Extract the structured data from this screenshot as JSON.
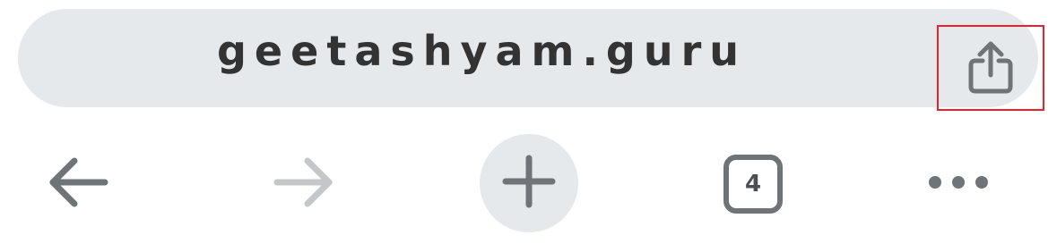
{
  "address_bar": {
    "url": "geetashyam.guru",
    "share_icon": "share-icon"
  },
  "toolbar": {
    "back_icon": "arrow-left-icon",
    "forward_icon": "arrow-right-icon",
    "new_tab_icon": "plus-icon",
    "tab_count": "4",
    "more_icon": "ellipsis-icon"
  },
  "colors": {
    "bar_background": "#e6e9ec",
    "icon_gray": "#6f7478",
    "disabled_gray": "#c4c7ca",
    "highlight_red": "#e0262c",
    "url_text": "#333333"
  }
}
